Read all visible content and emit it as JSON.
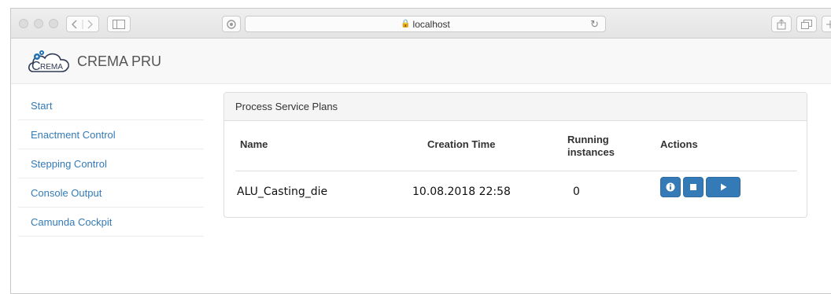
{
  "browser": {
    "url": "localhost",
    "lock_glyph": "🔒",
    "reload_glyph": "↻"
  },
  "app": {
    "brand_logo_text": "REMA",
    "brand_logo_initial": "C",
    "brand_name": "CREMA PRU"
  },
  "sidebar": {
    "items": [
      {
        "label": "Start"
      },
      {
        "label": "Enactment Control"
      },
      {
        "label": "Stepping Control"
      },
      {
        "label": "Console Output"
      },
      {
        "label": "Camunda Cockpit"
      }
    ]
  },
  "panel": {
    "title": "Process Service Plans",
    "columns": {
      "name": "Name",
      "creation_time": "Creation Time",
      "running_line1": "Running",
      "running_line2": "instances",
      "actions": "Actions"
    },
    "rows": [
      {
        "name": "ALU_Casting_die",
        "creation_time": "10.08.2018 22:58",
        "running_instances": "0",
        "actions": [
          "info-icon",
          "stop-icon",
          "play-icon"
        ]
      }
    ]
  },
  "colors": {
    "link": "#337ab7",
    "button": "#337ab7",
    "header_bg": "#f8f8f8"
  }
}
